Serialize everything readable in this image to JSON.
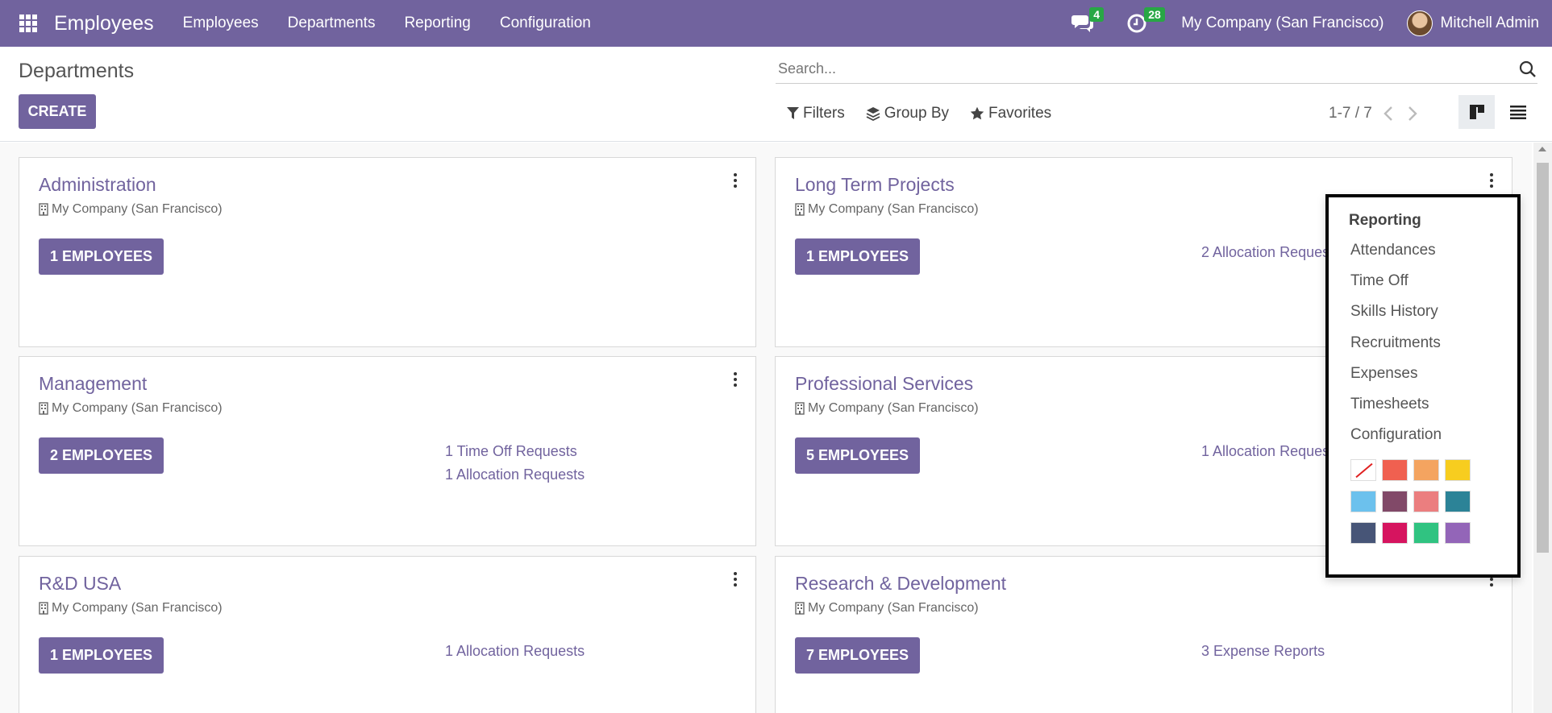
{
  "navbar": {
    "brand": "Employees",
    "menu": [
      "Employees",
      "Departments",
      "Reporting",
      "Configuration"
    ],
    "messages_count": "4",
    "activities_count": "28",
    "company": "My Company (San Francisco)",
    "user": "Mitchell Admin"
  },
  "control_panel": {
    "breadcrumb": "Departments",
    "create_label": "CREATE",
    "search_placeholder": "Search...",
    "filters_label": "Filters",
    "group_by_label": "Group By",
    "favorites_label": "Favorites",
    "pager": "1-7 / 7"
  },
  "cards": [
    {
      "title": "Administration",
      "company": "My Company (San Francisco)",
      "employees": "1 EMPLOYEES",
      "links": []
    },
    {
      "title": "Long Term Projects",
      "company": "My Company (San Francisco)",
      "employees": "1 EMPLOYEES",
      "links": [
        "2 Allocation Requests"
      ]
    },
    {
      "title": "Management",
      "company": "My Company (San Francisco)",
      "employees": "2 EMPLOYEES",
      "links": [
        "1 Time Off Requests",
        "1 Allocation Requests"
      ]
    },
    {
      "title": "Professional Services",
      "company": "My Company (San Francisco)",
      "employees": "5 EMPLOYEES",
      "links": [
        "1 Allocation Requests"
      ]
    },
    {
      "title": "R&D USA",
      "company": "My Company (San Francisco)",
      "employees": "1 EMPLOYEES",
      "links": [
        "1 Allocation Requests"
      ]
    },
    {
      "title": "Research & Development",
      "company": "My Company (San Francisco)",
      "employees": "7 EMPLOYEES",
      "links": [
        "3 Expense Reports"
      ]
    }
  ],
  "dropdown": {
    "header": "Reporting",
    "items": [
      "Attendances",
      "Time Off",
      "Skills History",
      "Recruitments",
      "Expenses",
      "Timesheets",
      "Configuration"
    ],
    "colors": [
      "#ffffff",
      "#f06050",
      "#f4a460",
      "#f7cd1f",
      "#6cc1ed",
      "#814968",
      "#eb7e7f",
      "#2c8397",
      "#475577",
      "#d6145f",
      "#30c381",
      "#9365b8"
    ]
  },
  "theme": {
    "primary": "#71639e",
    "badge": "#28a745"
  }
}
